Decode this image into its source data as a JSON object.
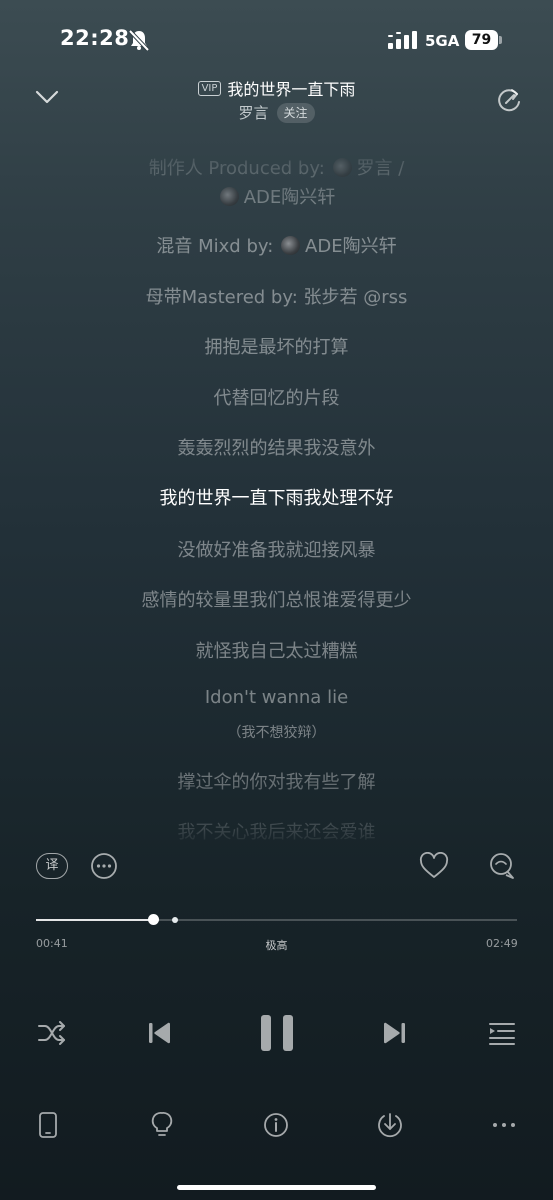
{
  "status_bar": {
    "time": "22:28",
    "network": "5GA",
    "battery": "79"
  },
  "header": {
    "vip_badge": "VIP",
    "song_title": "我的世界一直下雨",
    "artist": "罗言",
    "follow_label": "关注"
  },
  "lyrics": {
    "line_0a": "制作人 Produced by:",
    "line_0b": "罗言 /",
    "line_1": "ADE陶兴轩",
    "line_2a": "混音 Mixd by:",
    "line_2b": "ADE陶兴轩",
    "line_3": "母带Mastered by:  张步若 @rss",
    "line_4": "拥抱是最坏的打算",
    "line_5": "代替回忆的片段",
    "line_6": "轰轰烈烈的结果我没意外",
    "line_7": "我的世界一直下雨我处理不好",
    "line_8": "没做好准备我就迎接风暴",
    "line_9": "感情的较量里我们总恨谁爱得更少",
    "line_10": "就怪我自己太过糟糕",
    "line_11": "Idon't wanna lie",
    "line_11_translation": "（我不想狡辩）",
    "line_12": "撑过伞的你对我有些了解",
    "line_13": "我不关心我后来还会爱谁"
  },
  "translate_label": "译",
  "player": {
    "current_time": "00:41",
    "total_time": "02:49",
    "quality": "极高",
    "progress_fraction": 0.2426
  },
  "icons": {
    "more": "more-circle-icon",
    "like": "heart-icon",
    "comment": "comment-icon",
    "shuffle": "shuffle-icon",
    "prev": "previous-icon",
    "pause": "pause-icon",
    "next": "next-icon",
    "playlist": "playlist-icon"
  }
}
